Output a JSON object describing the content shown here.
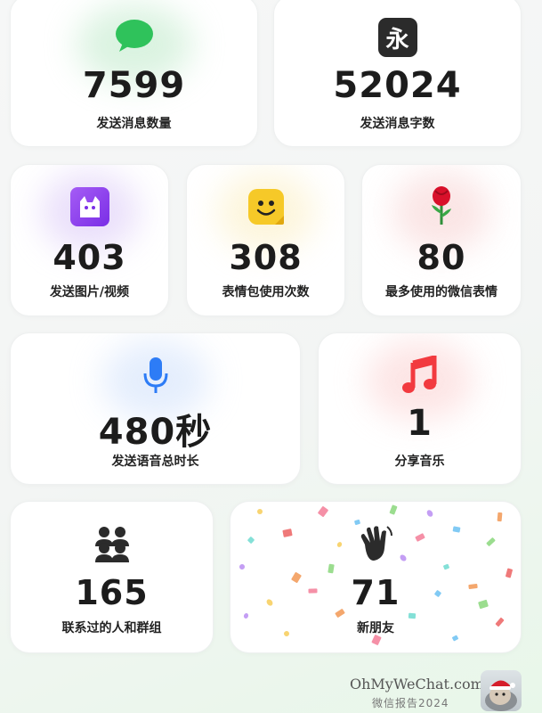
{
  "stats": {
    "messages": {
      "value": "7599",
      "label": "发送消息数量",
      "icon": "chat-bubble-icon",
      "color": "#2fc25b"
    },
    "characters": {
      "value": "52024",
      "label": "发送消息字数",
      "icon": "yong-character-icon",
      "glyph": "永"
    },
    "media": {
      "value": "403",
      "label": "发送图片/视频",
      "icon": "photo-cat-icon",
      "color": "#8e3cf0"
    },
    "stickers": {
      "value": "308",
      "label": "表情包使用次数",
      "icon": "smiley-sticker-icon",
      "color": "#f6c928"
    },
    "emoji": {
      "value": "80",
      "label": "最多使用的微信表情",
      "icon": "rose-icon",
      "glyph": "🌹"
    },
    "voice": {
      "value": "480秒",
      "label": "发送语音总时长",
      "icon": "microphone-icon",
      "color": "#2d7cf6"
    },
    "music": {
      "value": "1",
      "label": "分享音乐",
      "icon": "music-note-icon",
      "color": "#f23a3f"
    },
    "contacts": {
      "value": "165",
      "label": "联系过的人和群组",
      "icon": "group-people-icon"
    },
    "friends": {
      "value": "71",
      "label": "新朋友",
      "icon": "waving-hand-icon"
    }
  },
  "footer": {
    "site": "OhMyWeChat.com",
    "subtitle": "微信报告2024"
  }
}
